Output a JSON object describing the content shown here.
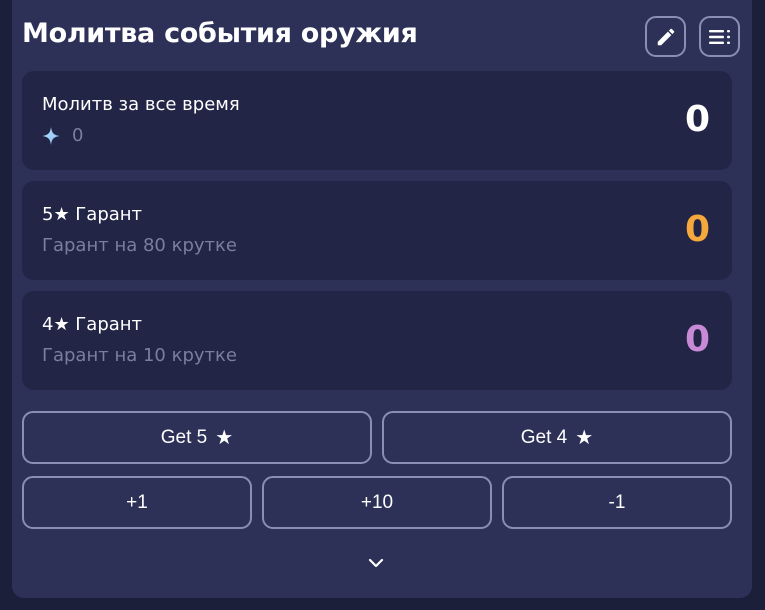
{
  "header": {
    "title": "Молитва события оружия",
    "edit_icon": "pencil-icon",
    "list_icon": "list-icon"
  },
  "stats": {
    "total": {
      "label": "Молитв за все время",
      "sub_value": "0",
      "sub_icon": "sparkle-icon",
      "value": "0",
      "color": "#ffffff"
    },
    "five_star": {
      "label": "5★ Гарант",
      "sub": "Гарант на 80 крутке",
      "value": "0",
      "color": "#f5a83c"
    },
    "four_star": {
      "label": "4★ Гарант",
      "sub": "Гарант на 10 крутке",
      "value": "0",
      "color": "#c88ad6"
    }
  },
  "buttons": {
    "get5": "Get 5",
    "get4": "Get 4",
    "plus1": "+1",
    "plus10": "+10",
    "minus1": "-1"
  },
  "icons": {
    "star": "★",
    "expand": "chevron-down-icon"
  },
  "colors": {
    "card_bg": "#2d3158",
    "stat_bg": "#222545",
    "border": "#8a8db4",
    "muted": "#7a7f9e"
  }
}
